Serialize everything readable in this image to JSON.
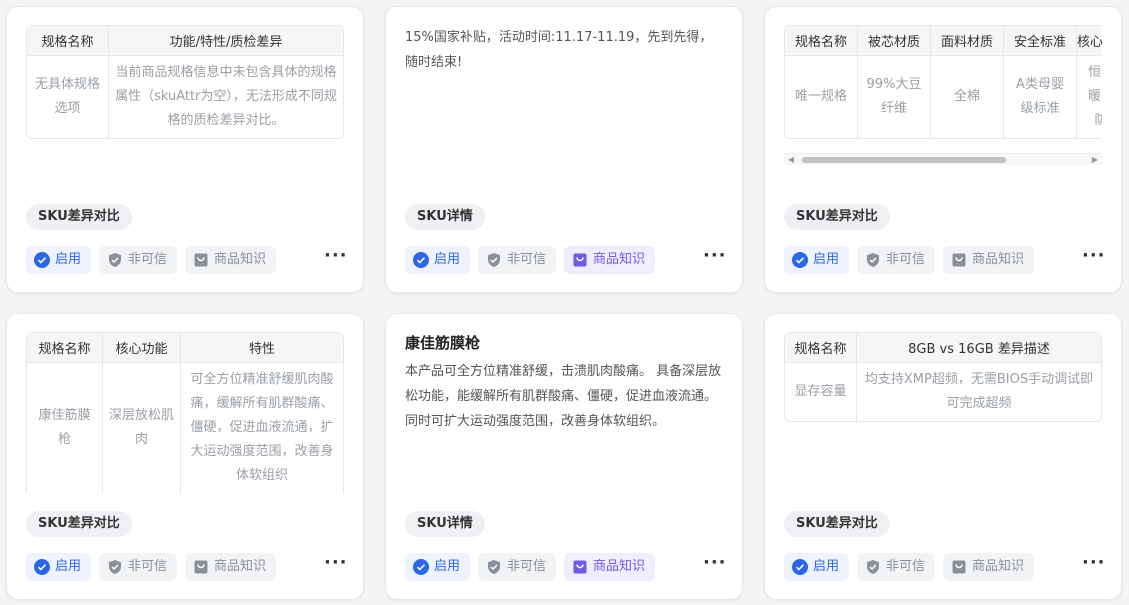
{
  "cards": [
    {
      "table": {
        "headers": [
          "规格名称",
          "功能/特性/质检差异"
        ],
        "rows": [
          [
            "无具体规格选项",
            "当前商品规格信息中未包含具体的规格属性（skuAttr为空），无法形成不同规格的质检差异对比。"
          ]
        ]
      },
      "tag": "SKU差异对比",
      "actions": {
        "enable": "启用",
        "untrusted": "非可信",
        "knowledge": "商品知识"
      }
    },
    {
      "text": "15%国家补贴，活动时间:11.17-11.19，先到先得，随时结束!",
      "tag": "SKU详情",
      "actions": {
        "enable": "启用",
        "untrusted": "非可信",
        "knowledge": "商品知识"
      }
    },
    {
      "table": {
        "headers": [
          "规格名称",
          "被芯材质",
          "面料材质",
          "安全标准",
          "核心"
        ],
        "rows": [
          [
            "唯一规格",
            "99%大豆纤维",
            "全棉",
            "A类母婴级标准",
            "恒温暖、防"
          ]
        ]
      },
      "tag": "SKU差异对比",
      "actions": {
        "enable": "启用",
        "untrusted": "非可信",
        "knowledge": "商品知识"
      }
    },
    {
      "table": {
        "headers": [
          "规格名称",
          "核心功能",
          "特性"
        ],
        "rows": [
          [
            "康佳筋膜枪",
            "深层放松肌肉",
            "可全方位精准舒缓肌肉酸痛，缓解所有肌群酸痛、僵硬，促进血液流通，扩大运动强度范围，改善身体软组织"
          ]
        ]
      },
      "tag": "SKU差异对比",
      "actions": {
        "enable": "启用",
        "untrusted": "非可信",
        "knowledge": "商品知识"
      }
    },
    {
      "title": "康佳筋膜枪",
      "text": "本产品可全方位精准舒缓，击溃肌肉酸痛。 具备深层放松功能，能缓解所有肌群酸痛、僵硬，促进血液流通。 同时可扩大运动强度范围，改善身体软组织。",
      "tag": "SKU详情",
      "actions": {
        "enable": "启用",
        "untrusted": "非可信",
        "knowledge": "商品知识"
      }
    },
    {
      "table": {
        "headers": [
          "规格名称",
          "8GB vs 16GB 差异描述"
        ],
        "rows": [
          [
            "显存容量",
            "均支持XMP超频，无需BIOS手动调试即可完成超频"
          ]
        ]
      },
      "tag": "SKU差异对比",
      "actions": {
        "enable": "启用",
        "untrusted": "非可信",
        "knowledge": "商品知识"
      }
    }
  ],
  "colors": {
    "accent": "#2b66e8",
    "knowledge_active": "#6f5be6",
    "muted": "#8a8f98"
  }
}
